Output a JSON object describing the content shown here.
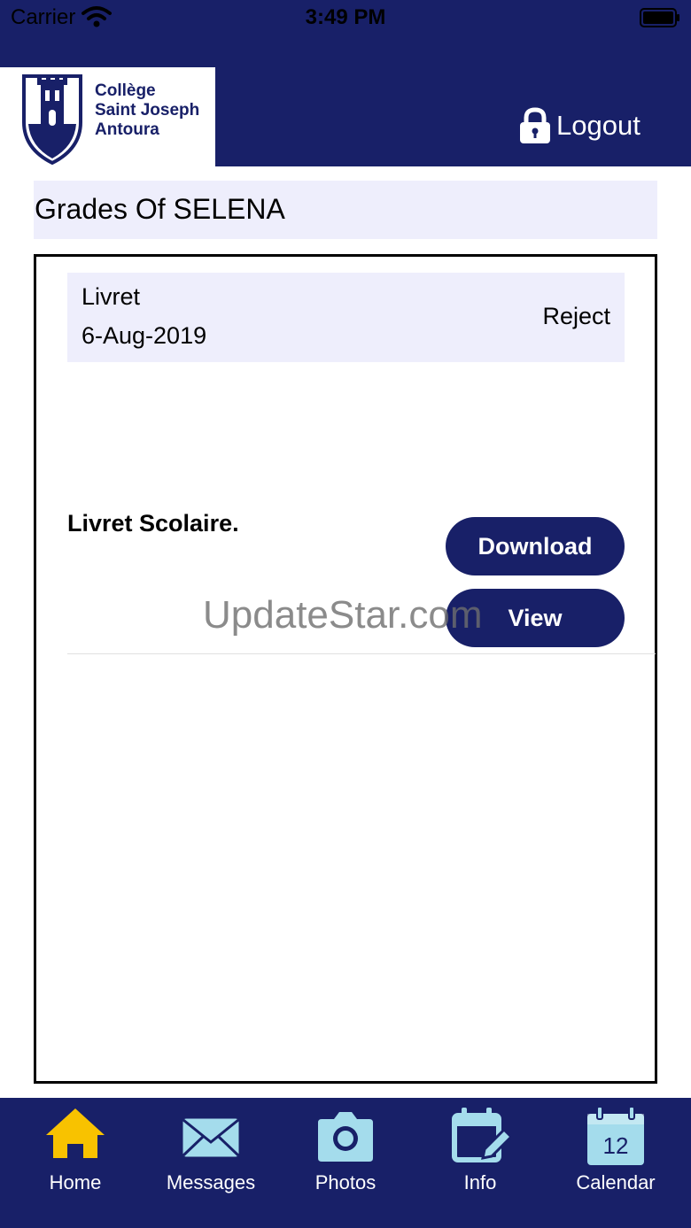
{
  "status_bar": {
    "carrier": "Carrier",
    "time": "3:49 PM"
  },
  "header": {
    "logo_lines": [
      "Collège",
      "Saint Joseph",
      "Antoura"
    ],
    "logout_label": "Logout"
  },
  "page": {
    "title": "Grades Of SELENA"
  },
  "grade": {
    "type": "Livret",
    "date": "6-Aug-2019",
    "status": "Reject",
    "description": "Livret Scolaire.",
    "download_label": "Download",
    "view_label": "View"
  },
  "watermark": "UpdateStar.com",
  "tabs": [
    {
      "label": "Home",
      "icon": "home-icon"
    },
    {
      "label": "Messages",
      "icon": "envelope-icon"
    },
    {
      "label": "Photos",
      "icon": "camera-icon"
    },
    {
      "label": "Info",
      "icon": "calendar-edit-icon"
    },
    {
      "label": "Calendar",
      "icon": "calendar-icon",
      "badge": "12"
    }
  ],
  "colors": {
    "brand_navy": "#182068",
    "card_bg": "#eeeefc",
    "home_icon": "#f8c200",
    "tab_icon": "#a4dcec"
  }
}
